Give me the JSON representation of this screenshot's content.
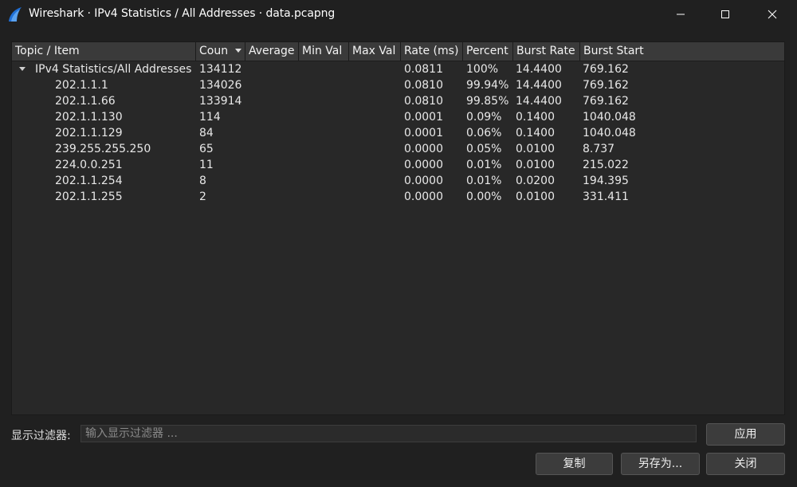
{
  "window": {
    "title": "Wireshark · IPv4 Statistics / All Addresses · data.pcapng",
    "icon": "wireshark-fin-icon"
  },
  "colors": {
    "background": "#202020",
    "table_bg": "#282828",
    "header_bg": "#3a3a3a",
    "app_icon_blue": "#1f6fd6"
  },
  "table": {
    "columns": [
      "Topic / Item",
      "Coun",
      "Average",
      "Min Val",
      "Max Val",
      "Rate (ms)",
      "Percent",
      "Burst Rate",
      "Burst Start"
    ],
    "sorted_column": "Coun",
    "rows": [
      {
        "topic": "IPv4 Statistics/All Addresses",
        "count": "134112",
        "average": "",
        "min": "",
        "max": "",
        "rate": "0.0811",
        "percent": "100%",
        "burst_rate": "14.4400",
        "burst_start": "769.162"
      },
      {
        "topic": "202.1.1.1",
        "count": "134026",
        "average": "",
        "min": "",
        "max": "",
        "rate": "0.0810",
        "percent": "99.94%",
        "burst_rate": "14.4400",
        "burst_start": "769.162"
      },
      {
        "topic": "202.1.1.66",
        "count": "133914",
        "average": "",
        "min": "",
        "max": "",
        "rate": "0.0810",
        "percent": "99.85%",
        "burst_rate": "14.4400",
        "burst_start": "769.162"
      },
      {
        "topic": "202.1.1.130",
        "count": "114",
        "average": "",
        "min": "",
        "max": "",
        "rate": "0.0001",
        "percent": "0.09%",
        "burst_rate": "0.1400",
        "burst_start": "1040.048"
      },
      {
        "topic": "202.1.1.129",
        "count": "84",
        "average": "",
        "min": "",
        "max": "",
        "rate": "0.0001",
        "percent": "0.06%",
        "burst_rate": "0.1400",
        "burst_start": "1040.048"
      },
      {
        "topic": "239.255.255.250",
        "count": "65",
        "average": "",
        "min": "",
        "max": "",
        "rate": "0.0000",
        "percent": "0.05%",
        "burst_rate": "0.0100",
        "burst_start": "8.737"
      },
      {
        "topic": "224.0.0.251",
        "count": "11",
        "average": "",
        "min": "",
        "max": "",
        "rate": "0.0000",
        "percent": "0.01%",
        "burst_rate": "0.0100",
        "burst_start": "215.022"
      },
      {
        "topic": "202.1.1.254",
        "count": "8",
        "average": "",
        "min": "",
        "max": "",
        "rate": "0.0000",
        "percent": "0.01%",
        "burst_rate": "0.0200",
        "burst_start": "194.395"
      },
      {
        "topic": "202.1.1.255",
        "count": "2",
        "average": "",
        "min": "",
        "max": "",
        "rate": "0.0000",
        "percent": "0.00%",
        "burst_rate": "0.0100",
        "burst_start": "331.411"
      }
    ]
  },
  "filter": {
    "label": "显示过滤器:",
    "value": "",
    "placeholder": "输入显示过滤器 ..."
  },
  "buttons": {
    "apply": "应用",
    "copy": "复制",
    "save_as": "另存为...",
    "close": "关闭"
  }
}
